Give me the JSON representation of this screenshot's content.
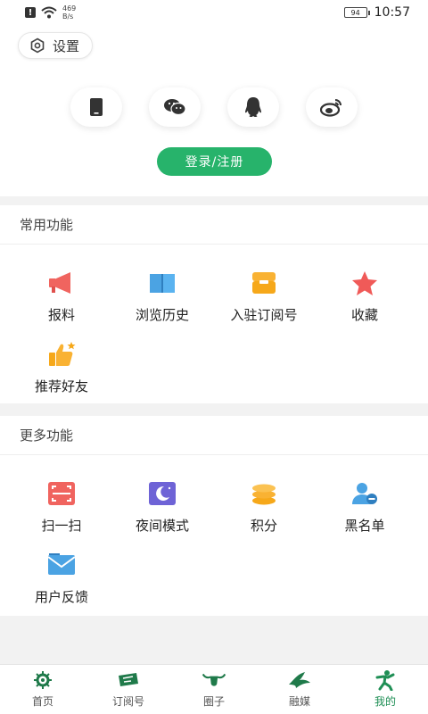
{
  "status_bar": {
    "speed_value": "469",
    "speed_unit": "B/s",
    "battery": "94",
    "time": "10:57"
  },
  "header": {
    "settings_label": "设置",
    "social_buttons": [
      "phone-icon",
      "wechat-icon",
      "qq-icon",
      "weibo-icon"
    ],
    "login_label": "登录/注册",
    "accent_color": "#27b36b"
  },
  "common": {
    "title": "常用功能",
    "items": [
      {
        "label": "报料",
        "icon": "megaphone-icon"
      },
      {
        "label": "浏览历史",
        "icon": "book-icon"
      },
      {
        "label": "入驻订阅号",
        "icon": "box-icon"
      },
      {
        "label": "收藏",
        "icon": "star-icon"
      },
      {
        "label": "推荐好友",
        "icon": "thumbs-up-icon"
      }
    ]
  },
  "more": {
    "title": "更多功能",
    "items": [
      {
        "label": "扫一扫",
        "icon": "scan-icon"
      },
      {
        "label": "夜间模式",
        "icon": "moon-icon"
      },
      {
        "label": "积分",
        "icon": "coins-icon"
      },
      {
        "label": "黑名单",
        "icon": "user-block-icon"
      },
      {
        "label": "用户反馈",
        "icon": "mail-icon"
      }
    ]
  },
  "tabbar": {
    "tabs": [
      {
        "label": "首页",
        "icon": "home-icon"
      },
      {
        "label": "订阅号",
        "icon": "subscription-icon"
      },
      {
        "label": "圈子",
        "icon": "bull-icon"
      },
      {
        "label": "融媒",
        "icon": "bird-icon"
      },
      {
        "label": "我的",
        "icon": "person-icon",
        "active": true
      }
    ]
  }
}
